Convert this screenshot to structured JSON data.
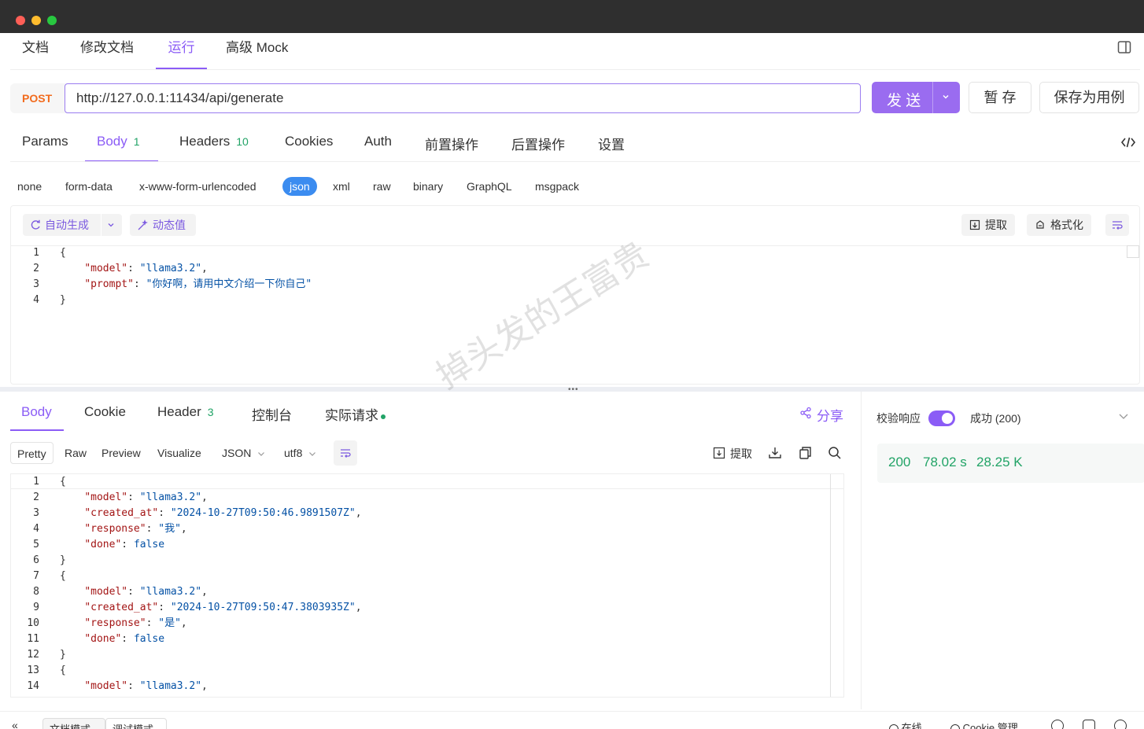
{
  "top_tabs": [
    "文档",
    "修改文档",
    "运行",
    "高级 Mock"
  ],
  "request": {
    "method": "POST",
    "url": "http://127.0.0.1:11434/api/generate",
    "send_label": "发 送",
    "save_temp_label": "暂 存",
    "save_case_label": "保存为用例"
  },
  "param_tabs": {
    "params": "Params",
    "body": "Body",
    "body_count": "1",
    "headers": "Headers",
    "headers_count": "10",
    "cookies": "Cookies",
    "auth": "Auth",
    "pre": "前置操作",
    "post": "后置操作",
    "settings": "设置"
  },
  "body_types": [
    "none",
    "form-data",
    "x-www-form-urlencoded",
    "json",
    "xml",
    "raw",
    "binary",
    "GraphQL",
    "msgpack"
  ],
  "editor_toolbar": {
    "auto_gen": "自动生成",
    "dynamic": "动态值",
    "extract": "提取",
    "format": "格式化"
  },
  "request_body_lines": [
    {
      "n": "1",
      "pre": "{",
      "k": "",
      "mid": "",
      "v": "",
      "post": ""
    },
    {
      "n": "2",
      "pre": "    ",
      "k": "\"model\"",
      "mid": ": ",
      "v": "\"llama3.2\"",
      "post": ","
    },
    {
      "n": "3",
      "pre": "    ",
      "k": "\"prompt\"",
      "mid": ": ",
      "v": "\"你好啊，请用中文介绍一下你自己\"",
      "post": ""
    },
    {
      "n": "4",
      "pre": "}",
      "k": "",
      "mid": "",
      "v": "",
      "post": ""
    }
  ],
  "response_tabs": {
    "body": "Body",
    "cookie": "Cookie",
    "header": "Header",
    "header_count": "3",
    "console": "控制台",
    "actual": "实际请求",
    "share": "分享"
  },
  "response_formats": {
    "pretty": "Pretty",
    "raw": "Raw",
    "preview": "Preview",
    "visualize": "Visualize",
    "json": "JSON",
    "utf8": "utf8",
    "extract": "提取"
  },
  "response_lines": [
    {
      "n": "1",
      "pre": "{",
      "k": "",
      "mid": "",
      "v": "",
      "post": ""
    },
    {
      "n": "2",
      "pre": "    ",
      "k": "\"model\"",
      "mid": ": ",
      "v": "\"llama3.2\"",
      "post": ","
    },
    {
      "n": "3",
      "pre": "    ",
      "k": "\"created_at\"",
      "mid": ": ",
      "v": "\"2024-10-27T09:50:46.9891507Z\"",
      "post": ","
    },
    {
      "n": "4",
      "pre": "    ",
      "k": "\"response\"",
      "mid": ": ",
      "v": "\"我\"",
      "post": ","
    },
    {
      "n": "5",
      "pre": "    ",
      "k": "\"done\"",
      "mid": ": ",
      "v": "false",
      "post": ""
    },
    {
      "n": "6",
      "pre": "}",
      "k": "",
      "mid": "",
      "v": "",
      "post": ""
    },
    {
      "n": "7",
      "pre": "{",
      "k": "",
      "mid": "",
      "v": "",
      "post": ""
    },
    {
      "n": "8",
      "pre": "    ",
      "k": "\"model\"",
      "mid": ": ",
      "v": "\"llama3.2\"",
      "post": ","
    },
    {
      "n": "9",
      "pre": "    ",
      "k": "\"created_at\"",
      "mid": ": ",
      "v": "\"2024-10-27T09:50:47.3803935Z\"",
      "post": ","
    },
    {
      "n": "10",
      "pre": "    ",
      "k": "\"response\"",
      "mid": ": ",
      "v": "\"是\"",
      "post": ","
    },
    {
      "n": "11",
      "pre": "    ",
      "k": "\"done\"",
      "mid": ": ",
      "v": "false",
      "post": ""
    },
    {
      "n": "12",
      "pre": "}",
      "k": "",
      "mid": "",
      "v": "",
      "post": ""
    },
    {
      "n": "13",
      "pre": "{",
      "k": "",
      "mid": "",
      "v": "",
      "post": ""
    },
    {
      "n": "14",
      "pre": "    ",
      "k": "\"model\"",
      "mid": ": ",
      "v": "\"llama3.2\"",
      "post": ","
    }
  ],
  "right_panel": {
    "validate_label": "校验响应",
    "status_text": "成功 (200)",
    "code": "200",
    "time": "78.02 s",
    "size": "28.25 K"
  },
  "footer": {
    "doc_mode": "文档模式",
    "debug_mode": "调试模式",
    "online": "在线",
    "cookie_mgmt": "Cookie 管理"
  },
  "watermark": "掉头发的王富贵",
  "colors": {
    "accent": "#8b5cf6",
    "method": "#f26b1d",
    "success": "#21a366",
    "json_tag": "#3b8cf0"
  }
}
